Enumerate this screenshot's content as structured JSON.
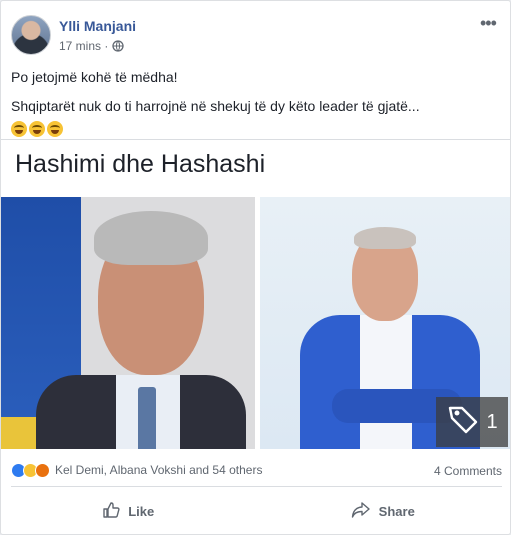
{
  "author": {
    "name": "Ylli Manjani"
  },
  "meta": {
    "time": "17 mins ·"
  },
  "post": {
    "line1": "Po jetojmë kohë të mëdha!",
    "line2": "Shqiptarët nuk do ti harrojnë në shekuj të dy këto leader të gjatë...",
    "emoji_count": 3,
    "image_caption": "Hashimi dhe Hashashi",
    "photo_tag_count": "1"
  },
  "engagement": {
    "reactors": "Kel Demi, Albana Vokshi and 54 others",
    "comments": "4 Comments"
  },
  "actions": {
    "like": "Like",
    "share": "Share"
  },
  "icons": {
    "more": "more-options-icon",
    "audience": "globe-icon",
    "tag": "tag-icon",
    "like": "thumbs-up-icon",
    "share": "share-arrow-icon"
  },
  "colors": {
    "link": "#385898",
    "like": "#2e7bf0",
    "haha": "#f7c335",
    "angry": "#e9710f"
  }
}
